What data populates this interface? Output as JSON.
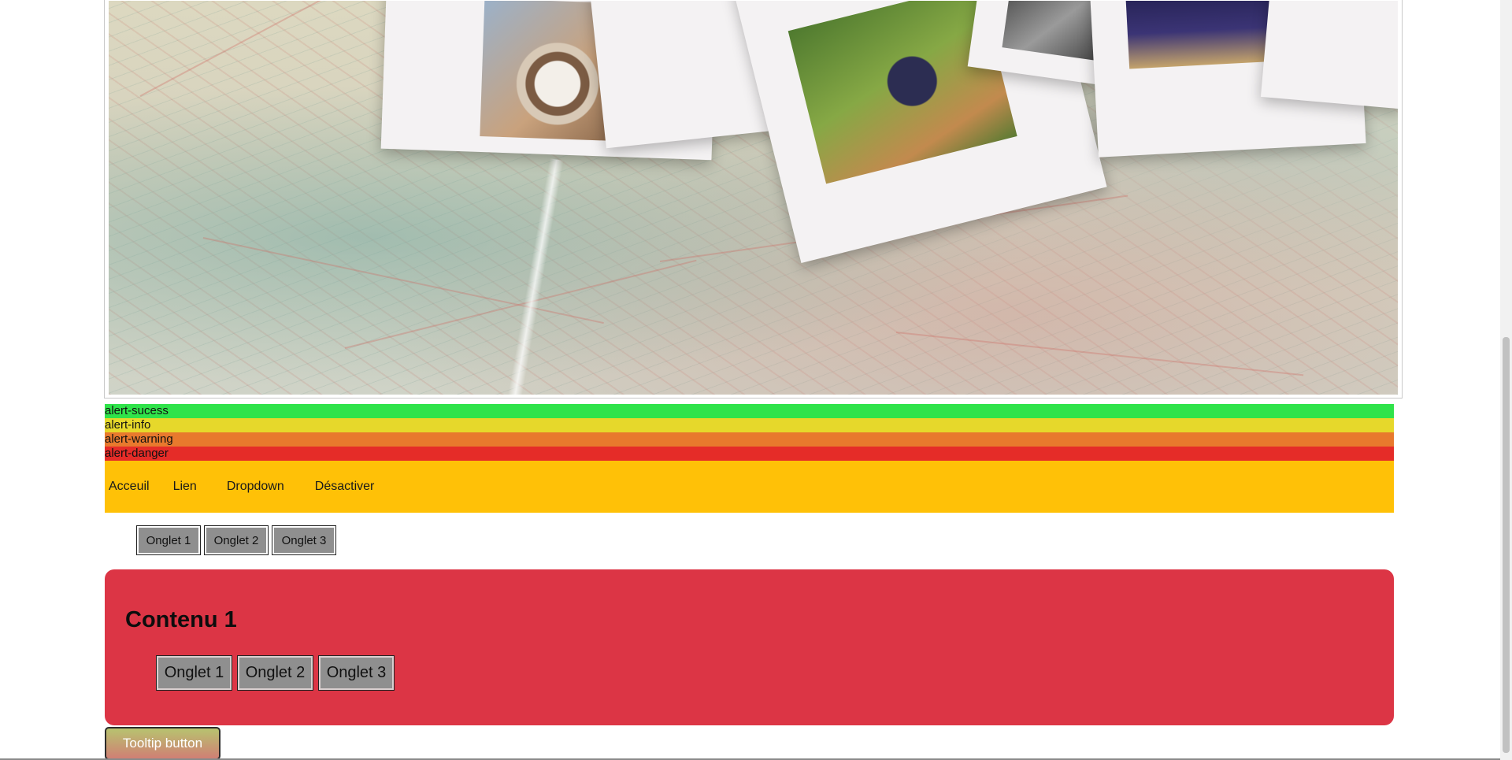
{
  "colors": {
    "alert_success": "#2fe34a",
    "alert_info": "#e6d82b",
    "alert_warning": "#e8792d",
    "alert_danger": "#e52c28",
    "navbar_bg": "#ffc107",
    "panel_bg": "#dc3545"
  },
  "alerts": [
    {
      "label": "alert-sucess"
    },
    {
      "label": "alert-info"
    },
    {
      "label": "alert-warning"
    },
    {
      "label": "alert-danger"
    }
  ],
  "navbar": {
    "links": [
      "Acceuil",
      "Lien",
      "Dropdown",
      "Désactiver"
    ]
  },
  "tabs": [
    "Onglet 1",
    "Onglet 2",
    "Onglet 3"
  ],
  "content": {
    "title": "Contenu 1",
    "tabs": [
      "Onglet 1",
      "Onglet 2",
      "Onglet 3"
    ]
  },
  "tooltip_button": {
    "label": "Tooltip button"
  }
}
